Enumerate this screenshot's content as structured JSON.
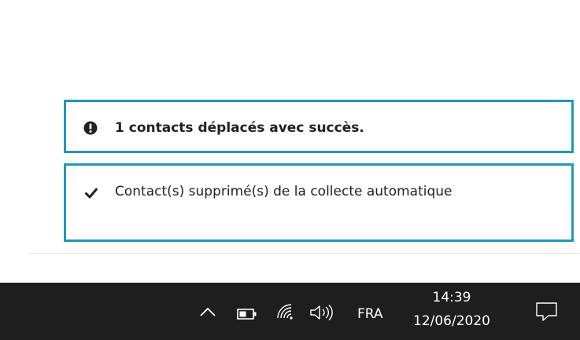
{
  "toasts": [
    {
      "icon": "exclamation-circle-icon",
      "message": "1 contacts déplacés avec succès."
    },
    {
      "icon": "checkmark-icon",
      "message": "Contact(s) supprimé(s) de la collecte automatique"
    }
  ],
  "colors": {
    "toast_border": "#1e9ab3",
    "taskbar": "#1e1e1e"
  },
  "taskbar": {
    "language": "FRA",
    "time": "14:39",
    "date": "12/06/2020",
    "icons": [
      "chevron-up-icon",
      "battery-icon",
      "wifi-icon",
      "volume-icon",
      "notification-icon"
    ]
  }
}
